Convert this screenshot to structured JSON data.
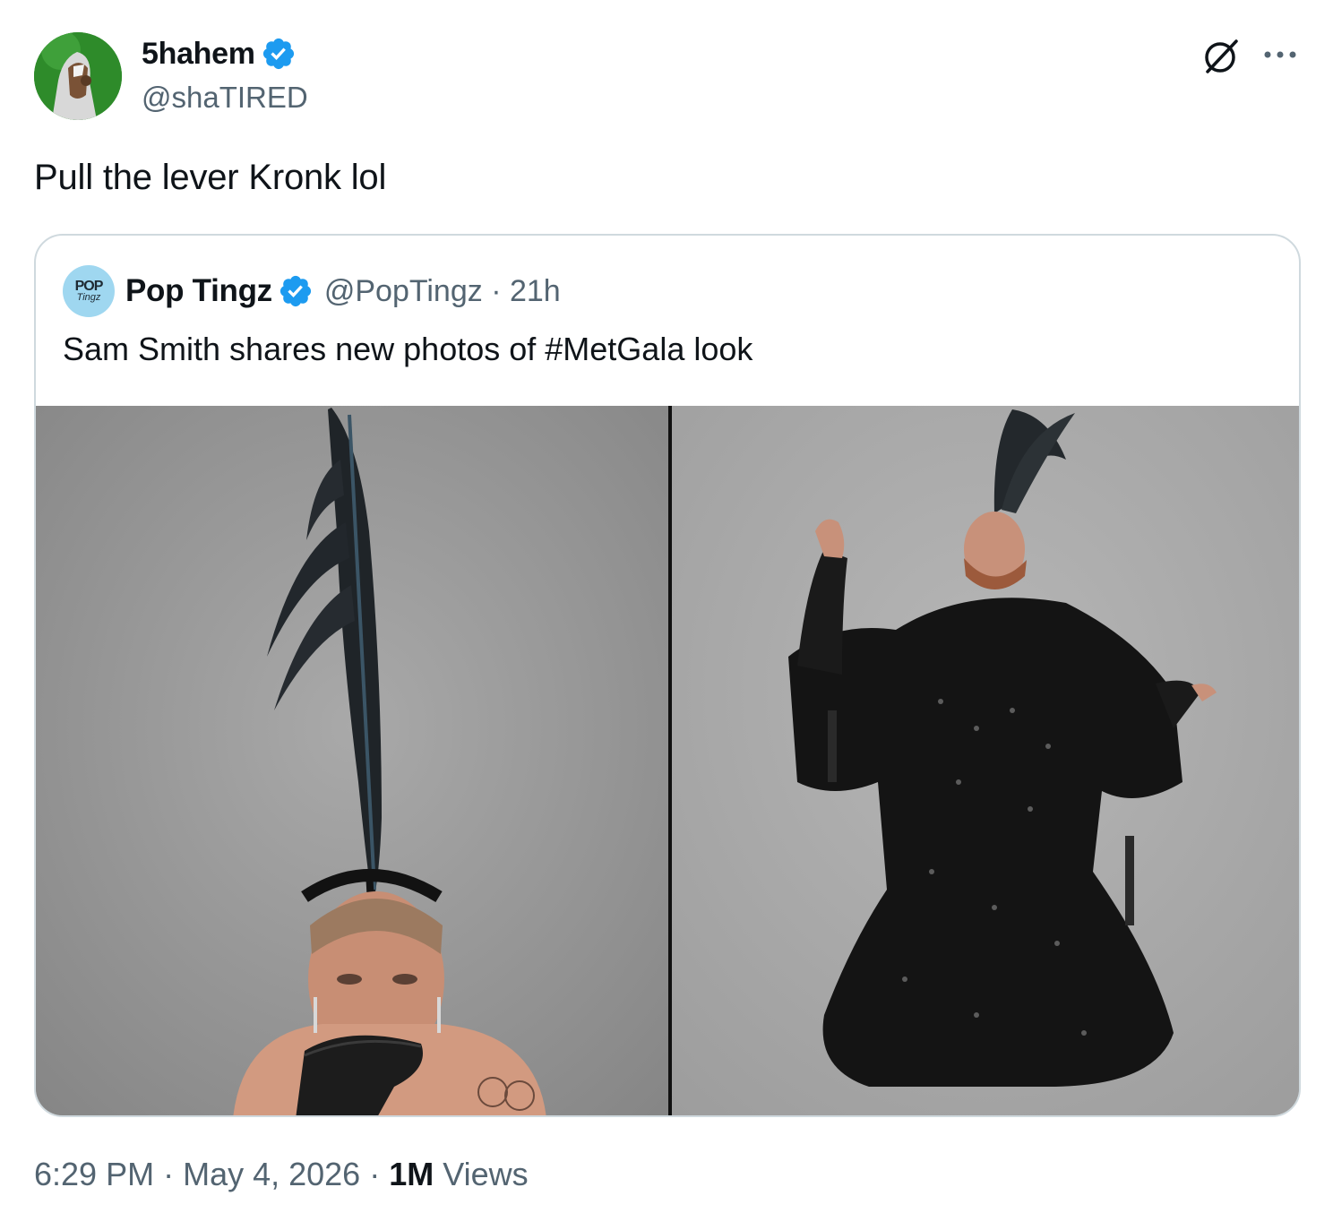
{
  "tweet": {
    "author": {
      "display_name": "5hahem",
      "handle": "@shaTIRED",
      "verified": true
    },
    "text": "Pull the lever Kronk lol",
    "footer": {
      "time": "6:29 PM",
      "date": "May 4, 2026",
      "views_count": "1M",
      "views_label": "Views"
    }
  },
  "quote": {
    "author": {
      "display_name": "Pop Tingz",
      "handle": "@PopTingz",
      "age": "21h",
      "avatar_text_1": "POP",
      "avatar_text_2": "Tingz",
      "verified": true
    },
    "text": "Sam Smith shares new photos of #MetGala look",
    "media": [
      {
        "name": "photo-1"
      },
      {
        "name": "photo-2"
      }
    ]
  },
  "icons": {
    "verified": "verified-badge-icon",
    "grok": "grok-icon",
    "more": "more-icon"
  },
  "colors": {
    "verified_blue": "#1d9bf0",
    "secondary_text": "#536471",
    "border": "#cfd9de"
  },
  "separator": "·"
}
